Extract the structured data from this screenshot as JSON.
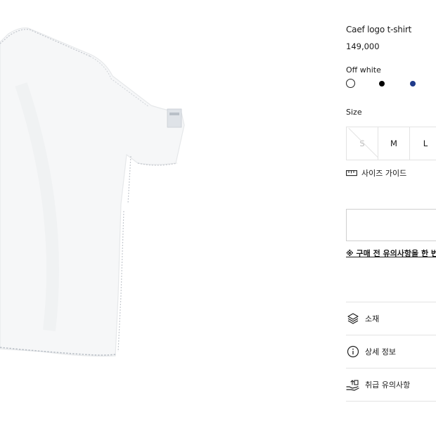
{
  "product": {
    "title": "Caef logo t-shirt",
    "price": "149,000",
    "color_selected": "Off white",
    "colors": [
      {
        "name": "off-white",
        "hex": "#ffffff"
      },
      {
        "name": "black",
        "hex": "#000000"
      },
      {
        "name": "navy",
        "hex": "#1f3a8a"
      }
    ]
  },
  "size": {
    "label": "Size",
    "options": [
      "S",
      "M",
      "L"
    ],
    "guide_label": "사이즈 가이드"
  },
  "notice_link": "※ 구매 전 유의사항을 한 번",
  "accordion": [
    {
      "label": "소재",
      "icon": "layers-icon"
    },
    {
      "label": "상세 정보",
      "icon": "info-icon"
    },
    {
      "label": "취급 유의사항",
      "icon": "hand-care-icon"
    }
  ]
}
